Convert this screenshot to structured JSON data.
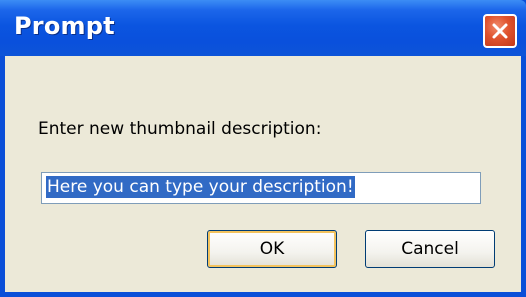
{
  "dialog": {
    "title": "Prompt",
    "message": "Enter new thumbnail description:",
    "input_value": "Here you can type your description!",
    "ok_label": "OK",
    "cancel_label": "Cancel"
  },
  "icons": {
    "close": "close-icon"
  },
  "colors": {
    "titlebar": "#0b55e0",
    "close_button": "#e0532e",
    "dialog_body": "#ece9d8",
    "selection": "#316ac5",
    "input_border": "#7f9db9"
  }
}
